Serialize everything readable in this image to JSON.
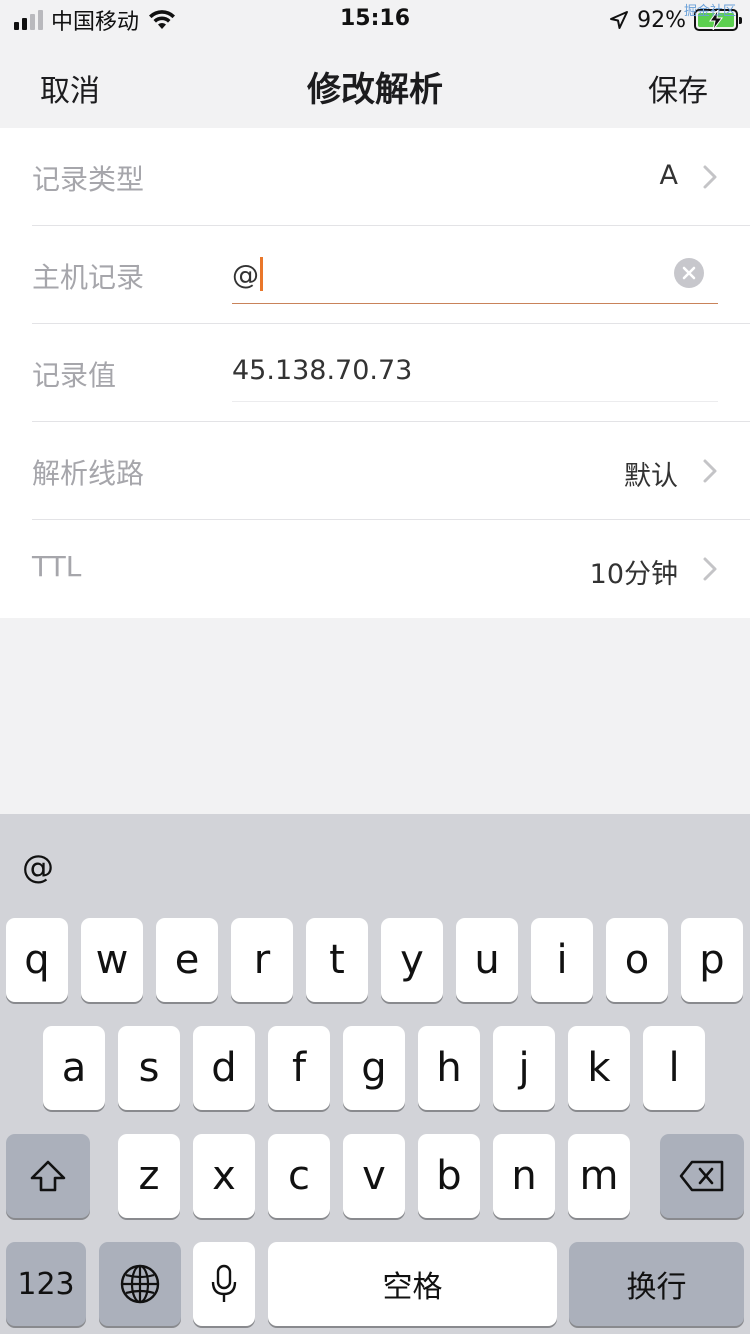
{
  "status_bar": {
    "carrier": "中国移动",
    "time": "15:16",
    "battery_percent": "92%",
    "watermark": "掘金社区",
    "signal_bars_filled": 2,
    "signal_bars_total": 4,
    "battery_level": 0.92,
    "battery_color": "#5ccf4f",
    "icons": [
      "signal-icon",
      "wifi-icon",
      "location-arrow-icon",
      "battery-icon"
    ]
  },
  "nav": {
    "cancel": "取消",
    "title": "修改解析",
    "save": "保存"
  },
  "form": {
    "rows": [
      {
        "label": "记录类型",
        "value": "A",
        "type": "select"
      },
      {
        "label": "主机记录",
        "value": "@",
        "type": "input-active"
      },
      {
        "label": "记录值",
        "value": "45.138.70.73",
        "type": "input"
      },
      {
        "label": "解析线路",
        "value": "默认",
        "type": "select"
      },
      {
        "label": "TTL",
        "value": "10分钟",
        "type": "select"
      }
    ]
  },
  "keyboard": {
    "suggestion": "@",
    "row1": [
      "q",
      "w",
      "e",
      "r",
      "t",
      "y",
      "u",
      "i",
      "o",
      "p"
    ],
    "row2": [
      "a",
      "s",
      "d",
      "f",
      "g",
      "h",
      "j",
      "k",
      "l"
    ],
    "row3": [
      "z",
      "x",
      "c",
      "v",
      "b",
      "n",
      "m"
    ],
    "numbers_key": "123",
    "space_key": "空格",
    "return_key": "换行"
  },
  "colors": {
    "accent_caret": "#e9772a",
    "active_underline": "#c9835a",
    "label_gray": "#a6a6ab"
  }
}
